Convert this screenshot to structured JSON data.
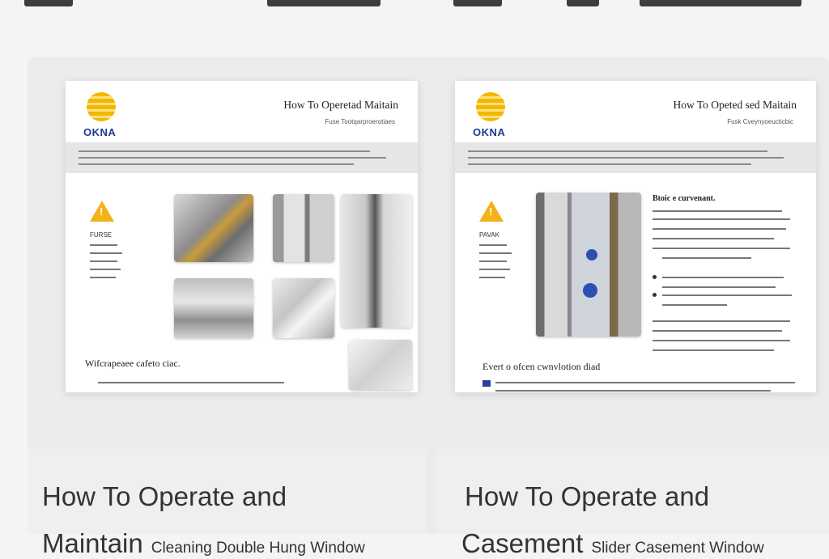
{
  "cards": [
    {
      "doc": {
        "logo_text": "OKNA",
        "title": "How To Operetad Maitain",
        "subtitle": "Fuse Tootqarproerotiaes",
        "warning_label": "FURSE",
        "footer_text": "Wifcrapeaee cafeto ciac."
      },
      "caption": {
        "line1": "How To Operate and",
        "line2_big": "Maintain",
        "line2_small": "Cleaning Double Hung Window"
      }
    },
    {
      "doc": {
        "logo_text": "OKNA",
        "title": "How To Opeted sed Maitain",
        "subtitle": "Fusk Cveynyoeucticbic",
        "warning_label": "PAVAK",
        "section_heading": "Btoic e curvenant.",
        "footer_text": "Evert o ofcen cwnvlotion diad"
      },
      "caption": {
        "line1": "How To Operate and",
        "line2_big": "Casement",
        "line2_small": "Slider Casement Window"
      }
    }
  ]
}
